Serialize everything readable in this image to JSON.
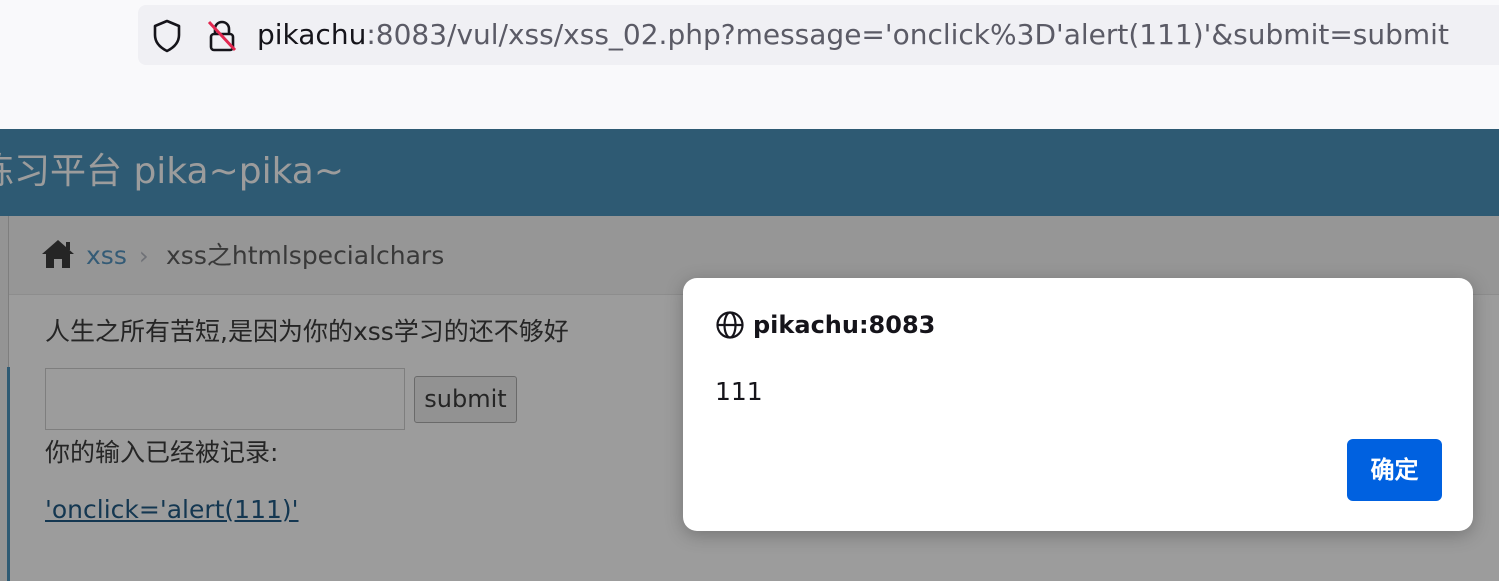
{
  "browser": {
    "url_host": "pikachu",
    "url_rest": ":8083/vul/xss/xss_02.php?message='onclick%3D'alert(111)'&submit=submit"
  },
  "header": {
    "title": "练习平台 pika~pika~"
  },
  "breadcrumb": {
    "link": "xss",
    "separator": "›",
    "current": "xss之htmlspecialchars"
  },
  "main": {
    "intro": "人生之所有苦短,是因为你的xss学习的还不够好",
    "input_value": "",
    "submit_label": "submit",
    "recorded_label": "你的输入已经被记录:",
    "injected_link": "'onclick='alert(111)'"
  },
  "dialog": {
    "origin": "pikachu:8083",
    "message": "111",
    "ok_label": "确定"
  },
  "colors": {
    "header": "#438eb9",
    "ok_button": "#0061e0",
    "link": "#4c8fbd"
  },
  "icons": [
    "shield-icon",
    "lock-icon",
    "home-icon",
    "globe-icon"
  ]
}
